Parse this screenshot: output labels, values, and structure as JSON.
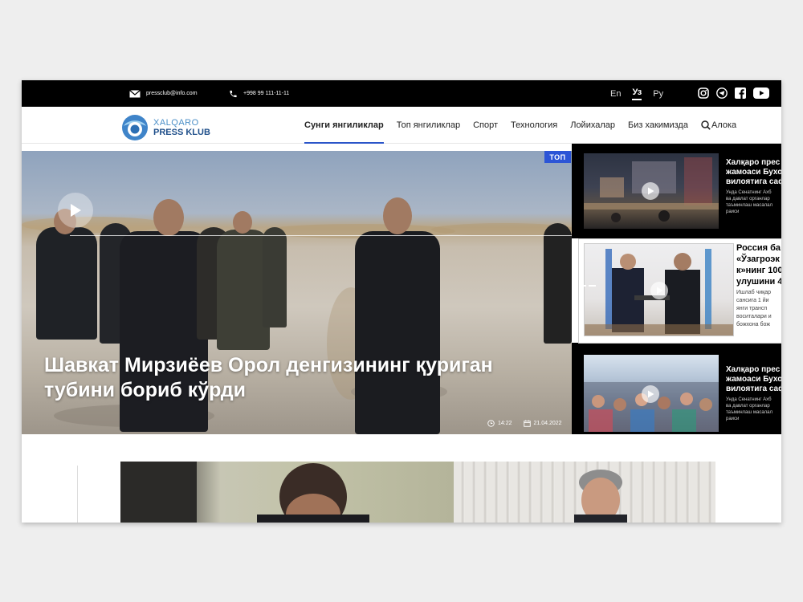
{
  "topbar": {
    "email": "pressclub@info.com",
    "phone": "+998 99 111-11-11",
    "languages": [
      {
        "code": "En",
        "active": false
      },
      {
        "code": "Уз",
        "active": true
      },
      {
        "code": "Ру",
        "active": false
      }
    ],
    "socials": [
      "instagram-icon",
      "telegram-icon",
      "facebook-icon",
      "youtube-icon"
    ]
  },
  "logo": {
    "line1": "XALQARO",
    "line2": "PRESS KLUB"
  },
  "nav": {
    "items": [
      {
        "label": "Сунги янгиликлар",
        "active": true
      },
      {
        "label": "Топ янгиликлар",
        "active": false
      },
      {
        "label": "Спорт",
        "active": false
      },
      {
        "label": "Технология",
        "active": false
      },
      {
        "label": "Лойихалар",
        "active": false
      },
      {
        "label": "Биз хакимизда",
        "active": false
      }
    ],
    "contact_label": "Алока"
  },
  "hero": {
    "badge": "ТОП",
    "title": "Шавкат Мирзиёев Орол денгизининг қуриган тубини бориб кўрди",
    "time": "14:22",
    "date": "21.04.2022"
  },
  "side_news": [
    {
      "title_lines": [
        "Халқаро прес",
        "жамоаси Бухо",
        "вилоятига саф"
      ],
      "desc_lines": [
        "Унда Сенатнинг Ахб",
        "ва давлат органлар",
        "таъминлаш масалал",
        "раиси"
      ]
    },
    {
      "title_lines": [
        "Россия ба",
        "«Ўзагроэк",
        "к»нинг 100",
        "улушини 4"
      ],
      "desc_lines": [
        "Ишлаб чиқар",
        "сансига 1 йи",
        "янги трансп",
        "воситалари и",
        "божхона бож"
      ]
    },
    {
      "title_lines": [
        "Халқаро прес",
        "жамоаси Бухо",
        "вилоятига саф"
      ],
      "desc_lines": [
        "Унда Сенатнинг Ахб",
        "ва давлат органлар",
        "таъминлаш масалал",
        "раиси"
      ]
    }
  ],
  "colors": {
    "accent": "#2a55c9",
    "badge": "#2c55d6",
    "topbar": "#000000"
  }
}
